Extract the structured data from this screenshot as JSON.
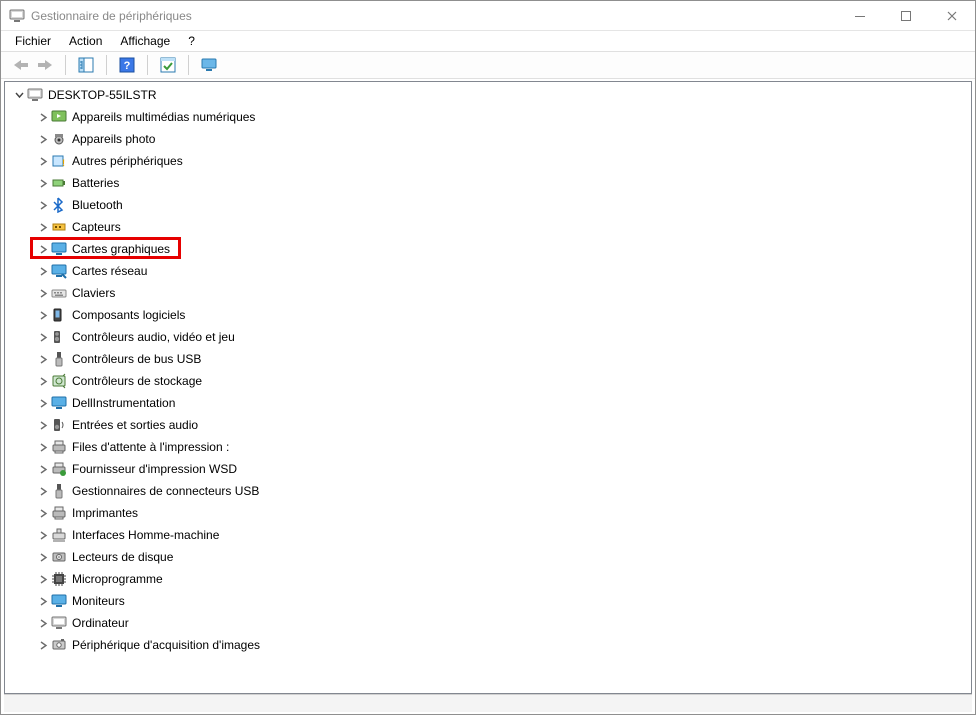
{
  "window": {
    "title": "Gestionnaire de périphériques"
  },
  "menu": {
    "file": "Fichier",
    "action": "Action",
    "view": "Affichage",
    "help": "?"
  },
  "tree": {
    "root": "DESKTOP-55ILSTR",
    "items": [
      {
        "icon": "media",
        "label": "Appareils multimédias numériques"
      },
      {
        "icon": "camera",
        "label": "Appareils photo"
      },
      {
        "icon": "other",
        "label": "Autres périphériques"
      },
      {
        "icon": "battery",
        "label": "Batteries"
      },
      {
        "icon": "bluetooth",
        "label": "Bluetooth"
      },
      {
        "icon": "sensor",
        "label": "Capteurs"
      },
      {
        "icon": "display",
        "label": "Cartes graphiques"
      },
      {
        "icon": "network",
        "label": "Cartes réseau"
      },
      {
        "icon": "keyboard",
        "label": "Claviers"
      },
      {
        "icon": "software",
        "label": "Composants logiciels"
      },
      {
        "icon": "audioctl",
        "label": "Contrôleurs audio, vidéo et jeu"
      },
      {
        "icon": "usb",
        "label": "Contrôleurs de bus USB"
      },
      {
        "icon": "storage",
        "label": "Contrôleurs de stockage"
      },
      {
        "icon": "monitor",
        "label": "DellInstrumentation"
      },
      {
        "icon": "speaker",
        "label": "Entrées et sorties audio"
      },
      {
        "icon": "printqueue",
        "label": "Files d'attente à l'impression :"
      },
      {
        "icon": "printprov",
        "label": "Fournisseur d'impression WSD"
      },
      {
        "icon": "usb",
        "label": "Gestionnaires de connecteurs USB"
      },
      {
        "icon": "printer",
        "label": "Imprimantes"
      },
      {
        "icon": "hid",
        "label": "Interfaces Homme-machine"
      },
      {
        "icon": "disk",
        "label": "Lecteurs de disque"
      },
      {
        "icon": "firmware",
        "label": "Microprogramme"
      },
      {
        "icon": "monitor",
        "label": "Moniteurs"
      },
      {
        "icon": "computer",
        "label": "Ordinateur"
      },
      {
        "icon": "capture",
        "label": "Périphérique d'acquisition d'images"
      }
    ],
    "highlighted_index": 6
  }
}
